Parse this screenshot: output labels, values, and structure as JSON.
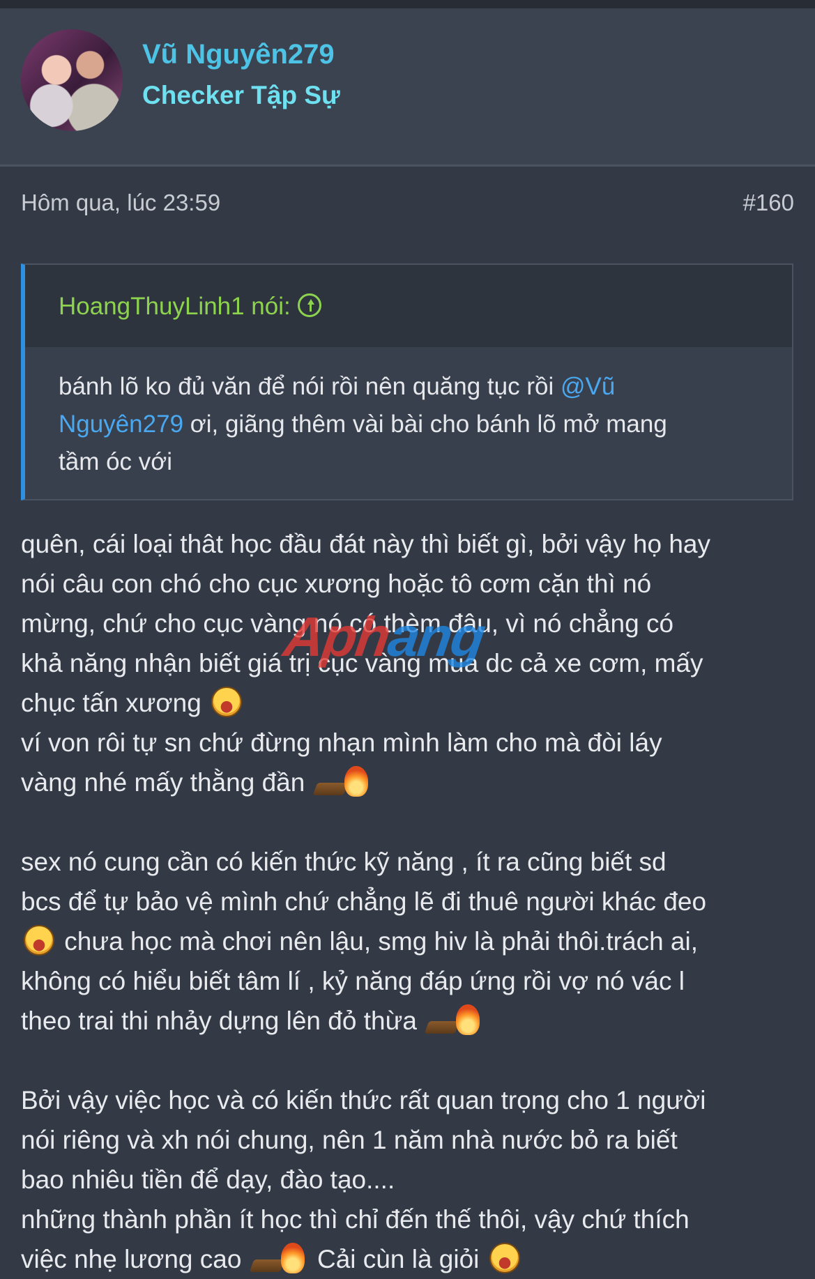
{
  "user": {
    "name": "Vũ Nguyên279",
    "title": "Checker Tập Sự"
  },
  "post_meta": {
    "date": "Hôm qua, lúc 23:59",
    "number": "#160"
  },
  "quote": {
    "author_label": "HoangThuyLinh1 nói:",
    "text_before": "bánh lõ ko đủ văn để nói rồi nên quăng tục rồi ",
    "mention_part1": "@Vũ",
    "mention_part2": "Nguyên279",
    "text_line2_after": " ơi, giãng thêm vài bài cho bánh lõ mở mang",
    "text_line3": "tầm óc với"
  },
  "watermark": {
    "part1": "Aph",
    "part2": "ang"
  },
  "post_lines": [
    "quên, cái loại thât học đầu đát này thì biết gì, bởi vậy họ hay",
    "nói câu con chó cho cục xương hoặc tô cơm cặn thì nó",
    "mừng, chứ cho cục vàng nó có thèm đâu, vì nó chẳng có",
    "khả năng nhận biết giá trị cục vàng mua dc cả xe cơm, mấy",
    "chục tấn xương",
    "ví von rôi tự sn chứ đừng nhạn mình làm cho mà đòi láy",
    "vàng nhé mấy thằng đần",
    "sex nó cung cần có kiến thức kỹ năng , ít ra cũng biết sd",
    "bcs để tự bảo vệ mình chứ chẳng lẽ đi thuê người khác đeo",
    " chưa học mà chơi nên lậu, smg hiv là phải thôi.trách ai,",
    "không có hiểu biết tâm lí , kỷ năng đáp ứng rồi vợ nó vác l",
    "theo trai thi nhảy dựng lên đỏ thừa",
    "Bởi vậy việc học và có kiến thức rất quan trọng cho 1 người",
    "nói riêng và xh nói chung, nên 1 năm nhà nước bỏ ra biết",
    "bao nhiêu tiền để dạy, đào tạo....",
    "những thành phần ít học thì chỉ đến thế thôi, vậy chứ thích",
    "việc nhẹ lương cao",
    " Cải cùn là giỏi"
  ]
}
